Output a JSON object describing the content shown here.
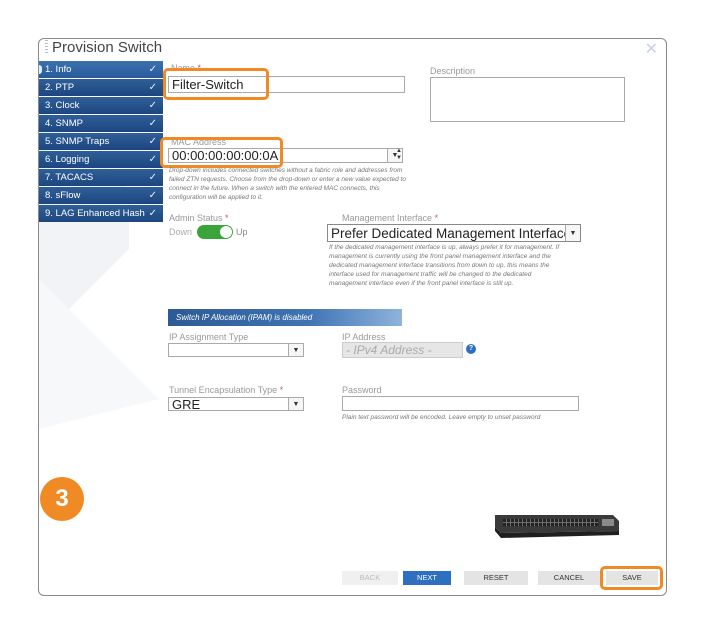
{
  "dialog": {
    "title": "Provision Switch"
  },
  "sidebar": {
    "items": [
      {
        "label": "1. Info"
      },
      {
        "label": "2. PTP"
      },
      {
        "label": "3. Clock"
      },
      {
        "label": "4. SNMP"
      },
      {
        "label": "5. SNMP Traps"
      },
      {
        "label": "6. Logging"
      },
      {
        "label": "7. TACACS"
      },
      {
        "label": "8. sFlow"
      },
      {
        "label": "9. LAG Enhanced Hash"
      }
    ]
  },
  "form": {
    "name_label": "Name",
    "name_value": "Filter-Switch",
    "description_label": "Description",
    "mac_label": "MAC Address",
    "mac_value": "00:00:00:00:00:0A",
    "mac_help": "Drop-down includes connected switches without a fabric role and addresses from failed ZTN requests. Choose from the drop-down or enter a new value expected to connect in the future. When a switch with the entered MAC connects, this configuration will be applied to it.",
    "admin_status_label": "Admin Status",
    "toggle_off": "Down",
    "toggle_on": "Up",
    "mgmt_label": "Management Interface",
    "mgmt_value": "Prefer Dedicated Management Interface",
    "mgmt_help": "If the dedicated management interface is up, always prefer it for management. If management is currently using the front panel management interface and the dedicated management interface transitions from down to up, this means the interface used for management traffic will be changed to the dedicated management interface even if the front panel interface is still up.",
    "ipam_banner": "Switch IP Allocation (IPAM) is disabled",
    "ip_assign_label": "IP Assignment Type",
    "ip_addr_label": "IP Address",
    "ip_addr_placeholder": "- IPv4 Address -",
    "tunnel_label": "Tunnel Encapsulation Type",
    "tunnel_value": "GRE",
    "password_label": "Password",
    "password_help": "Plain text password will be encoded. Leave empty to unset password"
  },
  "step_badge": "3",
  "buttons": {
    "back": "BACK",
    "next": "NEXT",
    "reset": "RESET",
    "cancel": "CANCEL",
    "save": "SAVE"
  },
  "colors": {
    "accent": "#f08a24",
    "sidebar": "#1d4680",
    "primary_button": "#2f6fc0"
  }
}
